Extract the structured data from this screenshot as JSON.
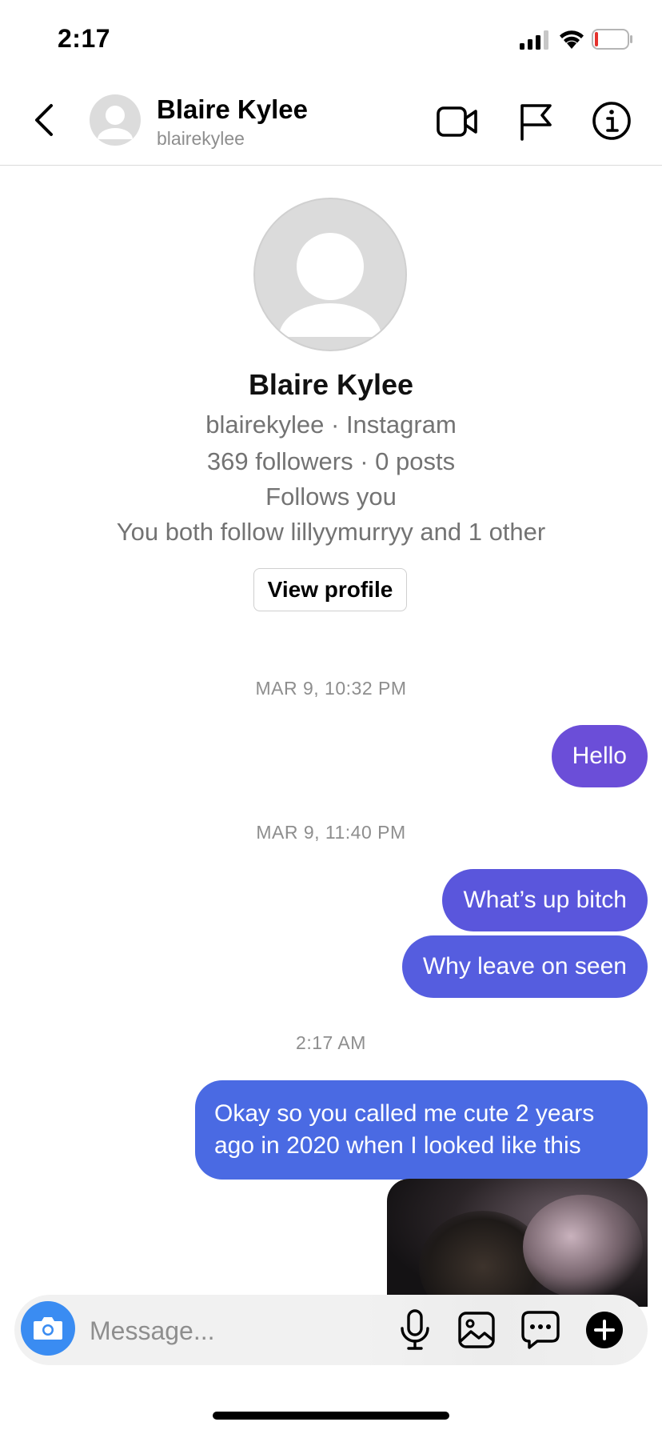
{
  "status_bar": {
    "time": "2:17"
  },
  "header": {
    "name": "Blaire Kylee",
    "username": "blairekylee",
    "icons": [
      "back-icon",
      "video-call-icon",
      "flag-icon",
      "info-icon"
    ]
  },
  "profile": {
    "name": "Blaire Kylee",
    "handle_line": "blairekylee · Instagram",
    "stats_line": "369 followers · 0 posts",
    "follows_line": "Follows you",
    "mutual_line": "You both follow lillyymurryy and 1 other",
    "view_profile_label": "View profile"
  },
  "messages": {
    "timestamp_1": "MAR 9, 10:32 PM",
    "msg_1": "Hello",
    "timestamp_2": "MAR 9, 11:40 PM",
    "msg_2": "What’s up bitch",
    "msg_3": "Why leave on seen",
    "timestamp_3": "2:17 AM",
    "msg_4": "Okay so you called me cute 2 years ago in 2020 when I looked like this"
  },
  "composer": {
    "placeholder": "Message...",
    "icons": [
      "camera-icon",
      "microphone-icon",
      "gallery-icon",
      "sticker-icon",
      "plus-icon"
    ]
  },
  "colors": {
    "bubble_gradient_top": "#6b4ed8",
    "bubble_gradient_bottom": "#4a6ae3",
    "camera_button": "#3a8cf2",
    "secondary_text": "#737373"
  }
}
